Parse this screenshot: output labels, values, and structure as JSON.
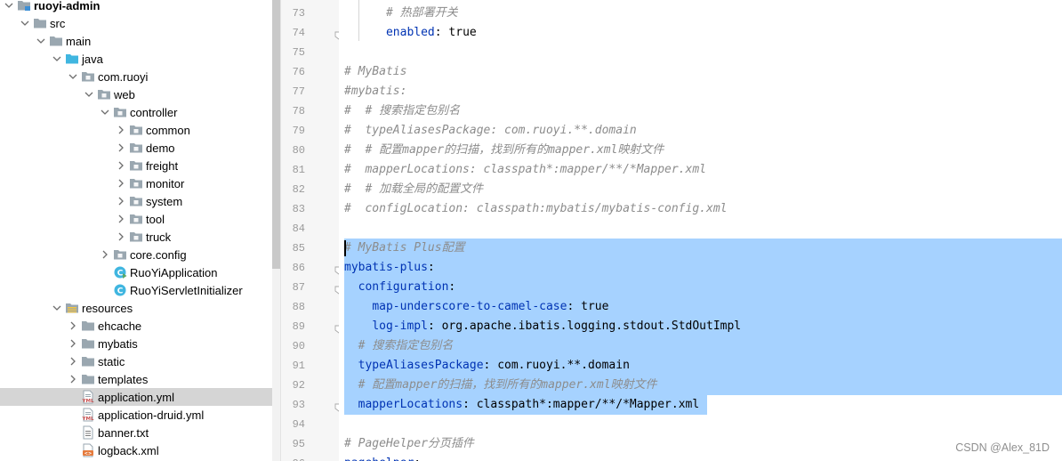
{
  "tree": {
    "rows": [
      {
        "label": "ruoyi-admin",
        "depth": 0,
        "state": "expanded",
        "icon": "module-folder",
        "bold": true
      },
      {
        "label": "src",
        "depth": 1,
        "state": "expanded",
        "icon": "folder"
      },
      {
        "label": "main",
        "depth": 2,
        "state": "expanded",
        "icon": "folder"
      },
      {
        "label": "java",
        "depth": 3,
        "state": "expanded",
        "icon": "source-folder"
      },
      {
        "label": "com.ruoyi",
        "depth": 4,
        "state": "expanded",
        "icon": "package"
      },
      {
        "label": "web",
        "depth": 5,
        "state": "expanded",
        "icon": "package"
      },
      {
        "label": "controller",
        "depth": 6,
        "state": "expanded",
        "icon": "package"
      },
      {
        "label": "common",
        "depth": 7,
        "state": "collapsed",
        "icon": "package"
      },
      {
        "label": "demo",
        "depth": 7,
        "state": "collapsed",
        "icon": "package"
      },
      {
        "label": "freight",
        "depth": 7,
        "state": "collapsed",
        "icon": "package"
      },
      {
        "label": "monitor",
        "depth": 7,
        "state": "collapsed",
        "icon": "package"
      },
      {
        "label": "system",
        "depth": 7,
        "state": "collapsed",
        "icon": "package"
      },
      {
        "label": "tool",
        "depth": 7,
        "state": "collapsed",
        "icon": "package"
      },
      {
        "label": "truck",
        "depth": 7,
        "state": "collapsed",
        "icon": "package"
      },
      {
        "label": "core.config",
        "depth": 6,
        "state": "collapsed",
        "icon": "package"
      },
      {
        "label": "RuoYiApplication",
        "depth": 6,
        "state": "leaf",
        "icon": "java-class-run"
      },
      {
        "label": "RuoYiServletInitializer",
        "depth": 6,
        "state": "leaf",
        "icon": "java-class"
      },
      {
        "label": "resources",
        "depth": 3,
        "state": "expanded",
        "icon": "resources-folder"
      },
      {
        "label": "ehcache",
        "depth": 4,
        "state": "collapsed",
        "icon": "folder"
      },
      {
        "label": "mybatis",
        "depth": 4,
        "state": "collapsed",
        "icon": "folder"
      },
      {
        "label": "static",
        "depth": 4,
        "state": "collapsed",
        "icon": "folder"
      },
      {
        "label": "templates",
        "depth": 4,
        "state": "collapsed",
        "icon": "folder"
      },
      {
        "label": "application.yml",
        "depth": 4,
        "state": "leaf",
        "icon": "yml-file",
        "selected": true
      },
      {
        "label": "application-druid.yml",
        "depth": 4,
        "state": "leaf",
        "icon": "yml-file"
      },
      {
        "label": "banner.txt",
        "depth": 4,
        "state": "leaf",
        "icon": "text-file"
      },
      {
        "label": "logback.xml",
        "depth": 4,
        "state": "leaf",
        "icon": "xml-file"
      }
    ]
  },
  "editor": {
    "lines": [
      {
        "num": "73",
        "segments": [
          {
            "t": "      ",
            "c": "val"
          },
          {
            "t": "# 热部署开关",
            "c": "comment"
          }
        ]
      },
      {
        "num": "74",
        "segments": [
          {
            "t": "      ",
            "c": "val"
          },
          {
            "t": "enabled",
            "c": "key"
          },
          {
            "t": ": true",
            "c": "val"
          }
        ],
        "fold": true
      },
      {
        "num": "75",
        "segments": []
      },
      {
        "num": "76",
        "segments": [
          {
            "t": "# MyBatis",
            "c": "comment"
          }
        ]
      },
      {
        "num": "77",
        "segments": [
          {
            "t": "#mybatis:",
            "c": "comment"
          }
        ]
      },
      {
        "num": "78",
        "segments": [
          {
            "t": "#  # 搜索指定包别名",
            "c": "comment"
          }
        ]
      },
      {
        "num": "79",
        "segments": [
          {
            "t": "#  typeAliasesPackage: com.ruoyi.**.domain",
            "c": "comment"
          }
        ]
      },
      {
        "num": "80",
        "segments": [
          {
            "t": "#  # 配置mapper的扫描，找到所有的mapper.xml映射文件",
            "c": "comment"
          }
        ]
      },
      {
        "num": "81",
        "segments": [
          {
            "t": "#  mapperLocations: classpath*:mapper/**/*Mapper.xml",
            "c": "comment"
          }
        ]
      },
      {
        "num": "82",
        "segments": [
          {
            "t": "#  # 加载全局的配置文件",
            "c": "comment"
          }
        ]
      },
      {
        "num": "83",
        "segments": [
          {
            "t": "#  configLocation: classpath:mybatis/mybatis-config.xml",
            "c": "comment"
          }
        ]
      },
      {
        "num": "84",
        "segments": []
      },
      {
        "num": "85",
        "segments": [
          {
            "t": "# MyBatis Plus配置",
            "c": "comment"
          }
        ],
        "selected": true
      },
      {
        "num": "86",
        "segments": [
          {
            "t": "mybatis-plus",
            "c": "key"
          },
          {
            "t": ":",
            "c": "val"
          }
        ],
        "selected": true,
        "fold": true
      },
      {
        "num": "87",
        "segments": [
          {
            "t": "  ",
            "c": "val"
          },
          {
            "t": "configuration",
            "c": "key"
          },
          {
            "t": ":",
            "c": "val"
          }
        ],
        "selected": true,
        "fold": true
      },
      {
        "num": "88",
        "segments": [
          {
            "t": "    ",
            "c": "val"
          },
          {
            "t": "map-underscore-to-camel-case",
            "c": "key"
          },
          {
            "t": ": true",
            "c": "val"
          }
        ],
        "selected": true
      },
      {
        "num": "89",
        "segments": [
          {
            "t": "    ",
            "c": "val"
          },
          {
            "t": "log-impl",
            "c": "key"
          },
          {
            "t": ": org.apache.ibatis.logging.stdout.StdOutImpl",
            "c": "val"
          }
        ],
        "selected": true,
        "fold": true
      },
      {
        "num": "90",
        "segments": [
          {
            "t": "  ",
            "c": "val"
          },
          {
            "t": "# 搜索指定包别名",
            "c": "comment"
          }
        ],
        "selected": true
      },
      {
        "num": "91",
        "segments": [
          {
            "t": "  ",
            "c": "val"
          },
          {
            "t": "typeAliasesPackage",
            "c": "key"
          },
          {
            "t": ": com.ruoyi.**.domain",
            "c": "val"
          }
        ],
        "selected": true
      },
      {
        "num": "92",
        "segments": [
          {
            "t": "  ",
            "c": "val"
          },
          {
            "t": "# 配置mapper的扫描，找到所有的mapper.xml映射文件",
            "c": "comment"
          }
        ],
        "selected": true
      },
      {
        "num": "93",
        "segments": [
          {
            "t": "  ",
            "c": "val"
          },
          {
            "t": "mapperLocations",
            "c": "key"
          },
          {
            "t": ": classpath*:mapper/**/*Mapper.xml",
            "c": "val"
          }
        ],
        "selected": true,
        "fold": true
      },
      {
        "num": "94",
        "segments": []
      },
      {
        "num": "95",
        "segments": [
          {
            "t": "# PageHelper分页插件",
            "c": "comment"
          }
        ]
      },
      {
        "num": "96",
        "segments": [
          {
            "t": "pagehelper",
            "c": "key"
          },
          {
            "t": ":",
            "c": "val"
          }
        ]
      }
    ],
    "watermark": "CSDN @Alex_81D"
  },
  "colors": {
    "selection": "#a6d2ff",
    "tree_selection": "#d5d5d5",
    "yaml_key": "#0033b3",
    "comment": "#8c8c8c",
    "folder": "#9aa7b0",
    "source_folder": "#40b6e0"
  }
}
